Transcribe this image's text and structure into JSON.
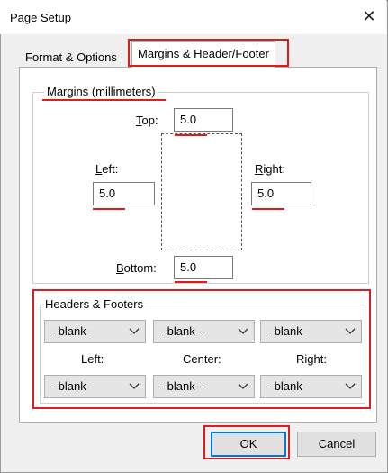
{
  "dialog": {
    "title": "Page Setup",
    "close_glyph": "✕"
  },
  "tabs": [
    {
      "label": "Format & Options"
    },
    {
      "label": "Margins & Header/Footer",
      "selected": true
    }
  ],
  "margins": {
    "legend": "Margins (millimeters)",
    "top": {
      "label_mnemonic": "T",
      "label_rest": "op:",
      "value": "5.0"
    },
    "left": {
      "label_mnemonic": "L",
      "label_rest": "eft:",
      "value": "5.0"
    },
    "right": {
      "label_mnemonic": "R",
      "label_rest": "ight:",
      "value": "5.0"
    },
    "bottom": {
      "label_mnemonic": "B",
      "label_rest": "ottom:",
      "value": "5.0"
    }
  },
  "headers_footers": {
    "legend": "Headers & Footers",
    "header_selects": [
      "--blank--",
      "--blank--",
      "--blank--"
    ],
    "column_labels": [
      "Left:",
      "Center:",
      "Right:"
    ],
    "footer_selects": [
      "--blank--",
      "--blank--",
      "--blank--"
    ]
  },
  "buttons": {
    "ok": "OK",
    "cancel": "Cancel"
  },
  "colors": {
    "highlight": "#e01b1b",
    "focus": "#0078d7"
  }
}
